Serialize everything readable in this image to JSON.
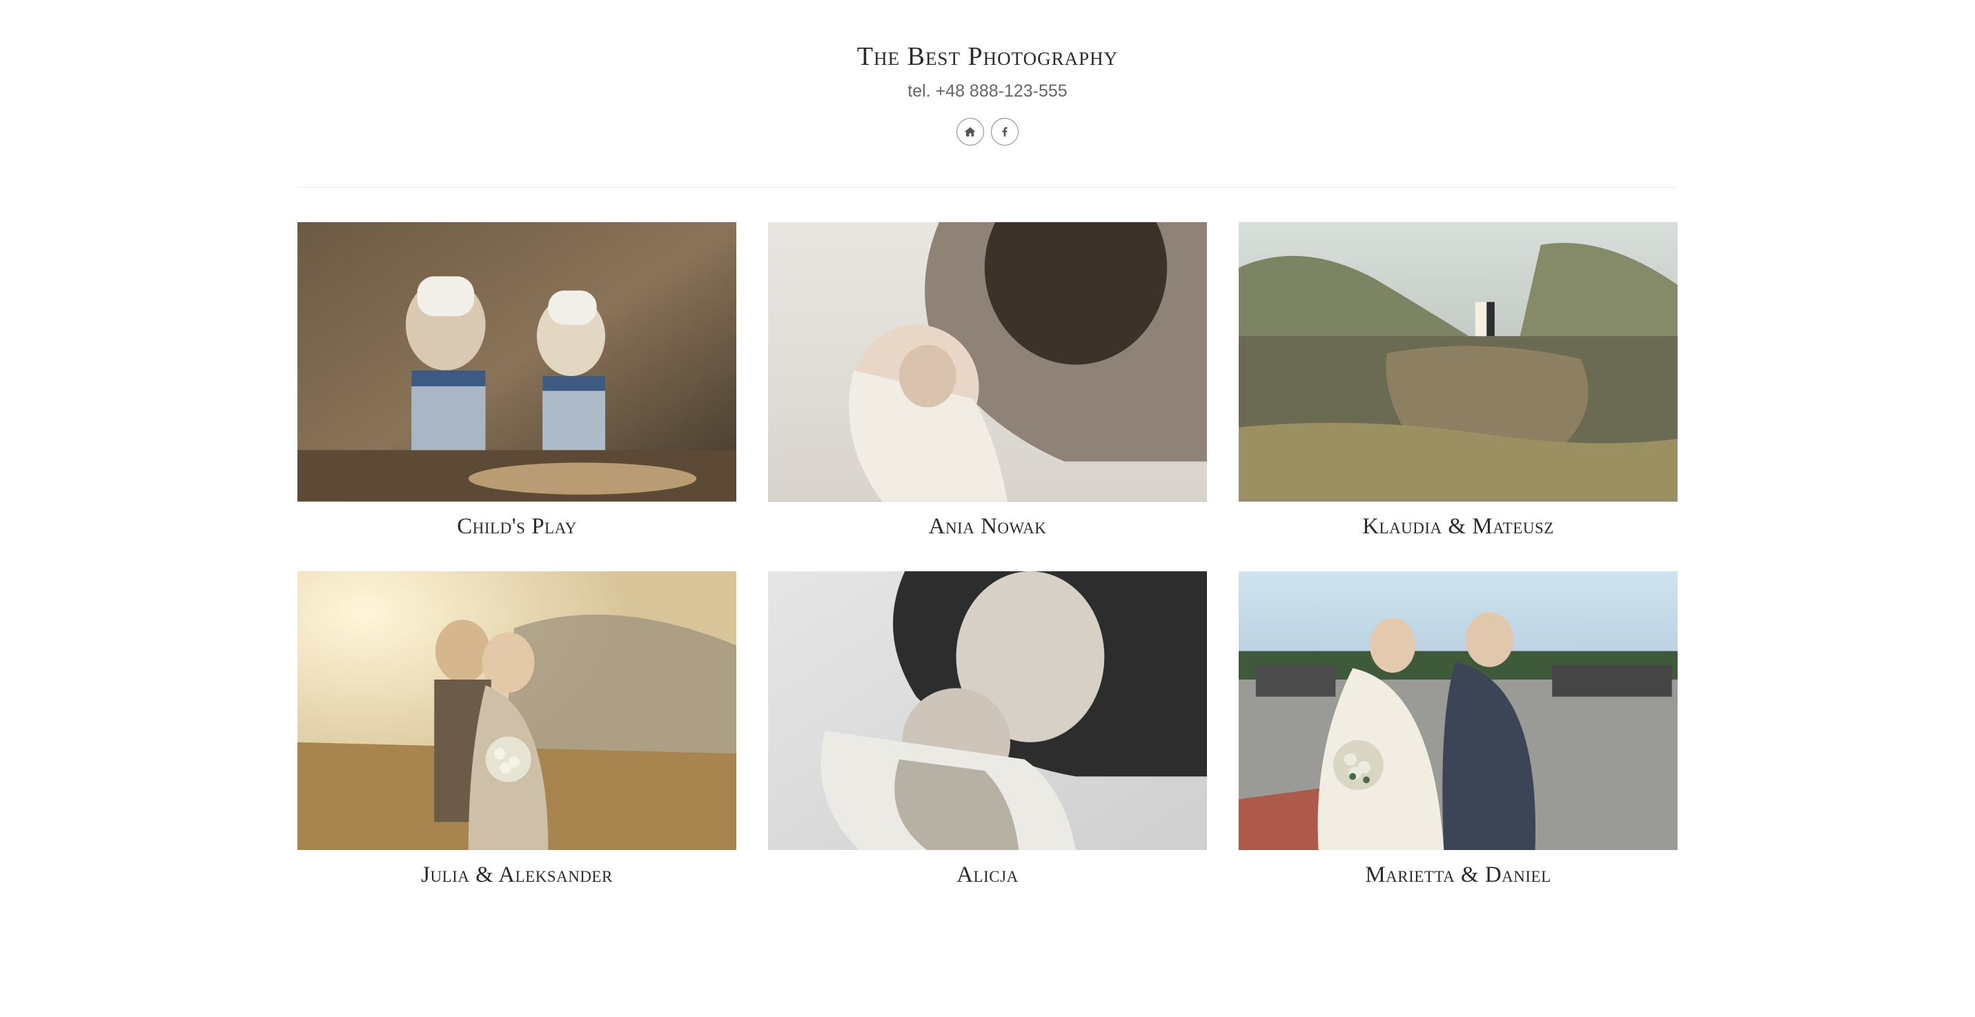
{
  "header": {
    "title": "The Best Photography",
    "phone": "tel. +48 888-123-555",
    "social_icons": {
      "home": "home-icon",
      "facebook": "facebook-icon"
    }
  },
  "gallery": [
    {
      "caption": "Child's Play",
      "img_desc": "children-baking-chef-hats"
    },
    {
      "caption": "Ania Nowak",
      "img_desc": "mother-kissing-baby"
    },
    {
      "caption": "Klaudia & Mateusz",
      "img_desc": "couple-on-cliff-wedding"
    },
    {
      "caption": "Julia & Aleksander",
      "img_desc": "couple-mountains-wedding"
    },
    {
      "caption": "Alicja",
      "img_desc": "mother-baby-bw"
    },
    {
      "caption": "Marietta & Daniel",
      "img_desc": "wedding-couple-walking"
    }
  ]
}
